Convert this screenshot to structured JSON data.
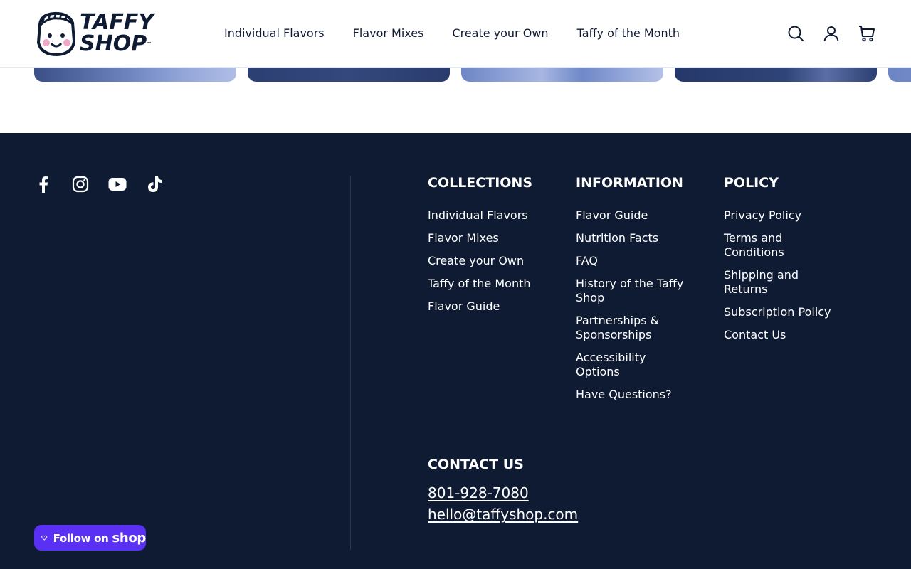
{
  "brand": {
    "logo_line1": "TAFFY",
    "logo_line2": "SHOP",
    "logo_tm": "™",
    "colors": {
      "navy": "#0e1b33",
      "shop_purple": "#5a31f4",
      "white": "#ffffff"
    }
  },
  "header": {
    "nav": [
      {
        "label": "Individual Flavors"
      },
      {
        "label": "Flavor Mixes"
      },
      {
        "label": "Create your Own"
      },
      {
        "label": "Taffy of the Month"
      }
    ],
    "icons": [
      "search-icon",
      "account-icon",
      "cart-icon"
    ]
  },
  "footer": {
    "social": [
      "facebook-icon",
      "instagram-icon",
      "youtube-icon",
      "tiktok-icon"
    ],
    "collections": {
      "heading": "COLLECTIONS",
      "links": [
        "Individual Flavors",
        "Flavor Mixes",
        "Create your Own",
        "Taffy of the Month",
        "Flavor Guide"
      ]
    },
    "information": {
      "heading": "INFORMATION",
      "links": [
        "Flavor Guide",
        "Nutrition Facts",
        "FAQ",
        "History of the Taffy Shop",
        "Partnerships & Sponsorships",
        "Accessibility Options",
        "Have Questions?"
      ]
    },
    "policy": {
      "heading": "POLICY",
      "links": [
        "Privacy Policy",
        "Terms and Conditions",
        "Shipping and Returns",
        "Subscription Policy",
        "Contact Us"
      ]
    },
    "contact": {
      "heading": "CONTACT US",
      "phone": "801-928-7080",
      "email": "hello@taffyshop.com"
    },
    "follow": {
      "label_prefix": "Follow on ",
      "label_brand": "shop"
    }
  }
}
